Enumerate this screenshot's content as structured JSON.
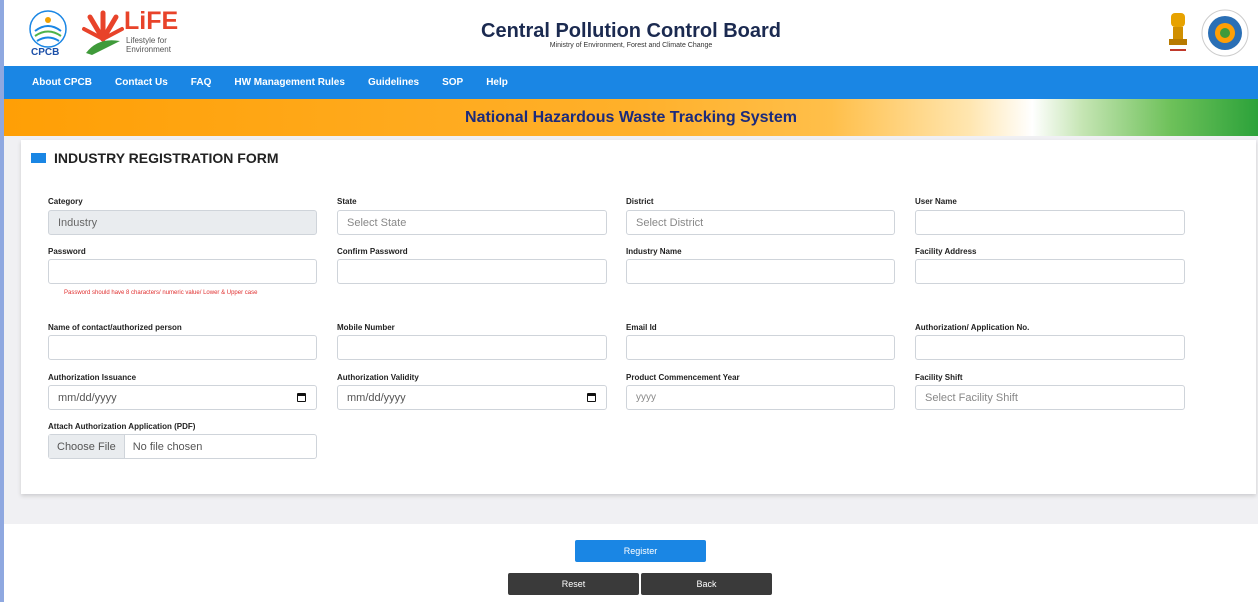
{
  "header": {
    "title": "Central Pollution Control Board",
    "subtitle": "Ministry of Environment, Forest and Climate Change",
    "cpcb_logo_text": "CPCB",
    "life_logo_text": "LiFE",
    "life_tagline_1": "Lifestyle for",
    "life_tagline_2": "Environment"
  },
  "nav": {
    "items": [
      "About CPCB",
      "Contact Us",
      "FAQ",
      "HW Management Rules",
      "Guidelines",
      "SOP",
      "Help"
    ]
  },
  "banner": {
    "title": "National Hazardous Waste Tracking System"
  },
  "form": {
    "title": "INDUSTRY REGISTRATION FORM",
    "category": {
      "label": "Category",
      "value": "Industry"
    },
    "state": {
      "label": "State",
      "placeholder": "Select State"
    },
    "district": {
      "label": "District",
      "placeholder": "Select District"
    },
    "username": {
      "label": "User Name",
      "value": ""
    },
    "password": {
      "label": "Password",
      "value": "",
      "hint": "Password should have 8 characters/ numeric value/ Lower & Upper case"
    },
    "confirm_password": {
      "label": "Confirm Password",
      "value": ""
    },
    "industry_name": {
      "label": "Industry Name",
      "value": ""
    },
    "facility_address": {
      "label": "Facility Address",
      "value": ""
    },
    "contact_person": {
      "label": "Name of contact/authorized person",
      "value": ""
    },
    "mobile": {
      "label": "Mobile Number",
      "value": ""
    },
    "email": {
      "label": "Email Id",
      "value": ""
    },
    "authorization_no": {
      "label": "Authorization/ Application No.",
      "value": ""
    },
    "auth_issuance": {
      "label": "Authorization Issuance",
      "placeholder": "mm/dd/yyyy"
    },
    "auth_validity": {
      "label": "Authorization Validity",
      "placeholder": "mm/dd/yyyy"
    },
    "commencement_year": {
      "label": "Product Commencement Year",
      "placeholder": "yyyy"
    },
    "facility_shift": {
      "label": "Facility Shift",
      "placeholder": "Select Facility Shift"
    },
    "attachment": {
      "label": "Attach Authorization Application (PDF)",
      "button": "Choose File",
      "status": "No file chosen"
    }
  },
  "actions": {
    "register": "Register",
    "reset": "Reset",
    "back": "Back"
  },
  "colors": {
    "accent": "#1a86e4",
    "banner_text": "#1b2a7c",
    "dark_button": "#3a3a3a",
    "error": "#e03030"
  }
}
